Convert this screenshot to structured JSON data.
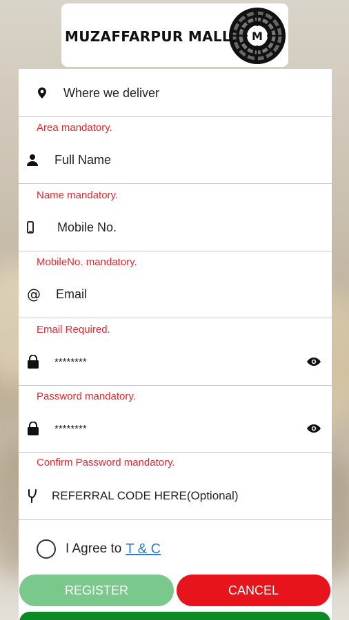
{
  "header": {
    "logo_text": "MUZAFFARPUR MALL",
    "emblem_letter": "M"
  },
  "form": {
    "area": {
      "placeholder": "Where we deliver",
      "error": "Area mandatory.",
      "icon": "location-pin-icon"
    },
    "name": {
      "placeholder": "Full Name",
      "error": "Name mandatory.",
      "icon": "person-icon"
    },
    "mobile": {
      "placeholder": "Mobile No.",
      "error": "MobileNo. mandatory.",
      "icon": "mobile-phone-icon"
    },
    "email": {
      "placeholder": "Email",
      "error": "Email Required.",
      "icon": "at-sign-icon"
    },
    "password": {
      "placeholder": "********",
      "error": "Password mandatory.",
      "icon": "lock-icon"
    },
    "confirm_password": {
      "placeholder": "********",
      "error": "Confirm Password mandatory.",
      "icon": "lock-icon"
    },
    "referral": {
      "placeholder": "REFERRAL CODE HERE(Optional)",
      "icon": "referral-icon"
    }
  },
  "terms": {
    "agree_text": "I Agree to",
    "link_text": "T & C",
    "checked": false
  },
  "buttons": {
    "register": "REGISTER",
    "cancel": "CANCEL"
  },
  "colors": {
    "error": "#e8252f",
    "register": "#7bc88c",
    "cancel": "#e7141b",
    "bottom_bar": "#0c8a23",
    "link": "#2a7bd4"
  }
}
